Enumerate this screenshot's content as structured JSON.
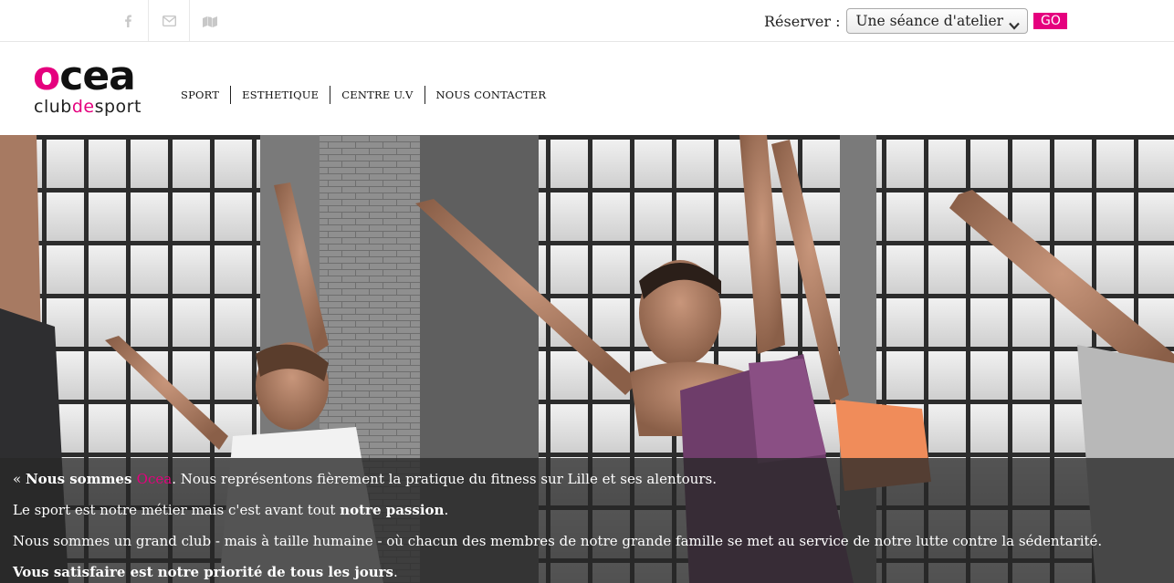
{
  "social": {
    "icons": [
      "facebook-icon",
      "envelope-icon",
      "map-icon"
    ]
  },
  "reserve": {
    "label": "Réserver :",
    "selected": "Une séance d'atelier",
    "go_label": "GO"
  },
  "logo": {
    "brand": "ocea",
    "sub_prefix": "club",
    "sub_accent": "de",
    "sub_suffix": "sport"
  },
  "nav": {
    "items": [
      {
        "label": "SPORT"
      },
      {
        "label": "ESTHETIQUE"
      },
      {
        "label": "CENTRE U.V"
      },
      {
        "label": "NOUS CONTACTER"
      }
    ]
  },
  "hero": {
    "line1": {
      "open": "« ",
      "bold": "Nous sommes ",
      "brand": "Ocea",
      "rest": ". Nous représentons fièrement la pratique du fitness sur Lille et ses alentours."
    },
    "line2": {
      "text": "Le sport est notre métier mais c'est avant tout ",
      "bold": "notre passion",
      "end": "."
    },
    "line3": "Nous sommes un grand club - mais à taille humaine - où chacun des membres de notre grande famille se met au service de notre lutte contre la sédentarité.",
    "line4": {
      "bold": "Vous satisfaire est notre priorité de tous les jours",
      "end": "."
    }
  },
  "colors": {
    "accent": "#e5007e",
    "caption_bg": "#282828"
  }
}
